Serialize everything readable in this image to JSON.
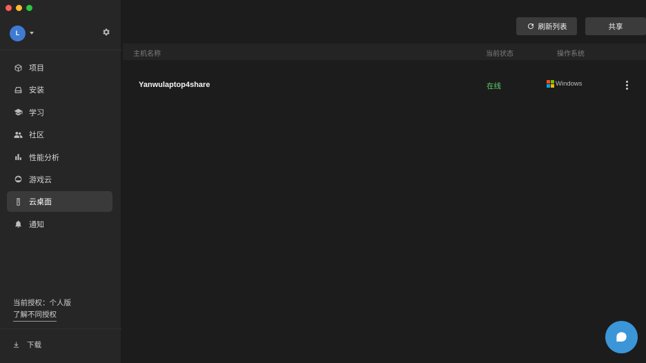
{
  "window": {
    "traffic_lights": [
      "close",
      "minimize",
      "zoom"
    ]
  },
  "user": {
    "avatar_letter": "L"
  },
  "sidebar": {
    "items": [
      {
        "label": "项目",
        "icon": "cube-icon",
        "active": false
      },
      {
        "label": "安装",
        "icon": "drive-icon",
        "active": false
      },
      {
        "label": "学习",
        "icon": "graduation-cap-icon",
        "active": false
      },
      {
        "label": "社区",
        "icon": "people-icon",
        "active": false
      },
      {
        "label": "性能分析",
        "icon": "bar-chart-icon",
        "active": false
      },
      {
        "label": "游戏云",
        "icon": "cloud-icon",
        "active": false
      },
      {
        "label": "云桌面",
        "icon": "remote-icon",
        "active": true
      },
      {
        "label": "通知",
        "icon": "bell-icon",
        "active": false
      }
    ],
    "license_text": "当前授权：个人版",
    "license_link": "了解不同授权",
    "download_label": "下载"
  },
  "toolbar": {
    "refresh_label": "刷新列表",
    "share_label": "共享"
  },
  "table": {
    "columns": [
      "主机名称",
      "当前状态",
      "操作系统"
    ],
    "rows": [
      {
        "host": "Yanwulaptop4share",
        "status": "在线",
        "os": "Windows"
      }
    ]
  },
  "colors": {
    "accent": "#3b96d8",
    "status_online": "#5fd068",
    "avatar": "#3f7bd2",
    "windows_logo": [
      "#f25022",
      "#7fba00",
      "#00a4ef",
      "#ffb900"
    ]
  }
}
